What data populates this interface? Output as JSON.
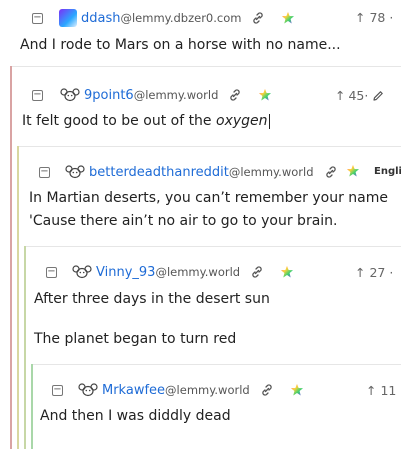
{
  "comments": [
    {
      "username": "ddash",
      "instance": "@lemmy.dbzer0.com",
      "votes": "78",
      "body": [
        "And I rode to Mars on a horse with no name..."
      ],
      "collapse": "−",
      "vote_prefix": "↑"
    },
    {
      "username": "9point6",
      "instance": "@lemmy.world",
      "votes": "45",
      "body_plain": "It felt good to be out of the ",
      "body_italic": "oxygen",
      "collapse": "−",
      "vote_prefix": "↑"
    },
    {
      "username": "betterdeadthanreddit",
      "instance": "@lemmy.world",
      "language": "Engli",
      "body": [
        "In Martian deserts, you can’t remember your name",
        "'Cause there ain’t no air to go to your brain."
      ],
      "collapse": "−"
    },
    {
      "username": "Vinny_93",
      "instance": "@lemmy.world",
      "votes": "27",
      "body": [
        "After three days in the desert sun",
        "The planet began to turn red"
      ],
      "collapse": "−",
      "vote_prefix": "↑"
    },
    {
      "username": "Mrkawfee",
      "instance": "@lemmy.world",
      "votes": "11",
      "body": [
        "And then I was diddly dead"
      ],
      "collapse": "−",
      "vote_prefix": "↑"
    }
  ],
  "colors": {
    "username": "#1e6bd6",
    "thread_line_1": "#d9a3a3",
    "thread_line_2": "#d8d7a0",
    "thread_line_3": "#c7d7a6",
    "thread_line_4": "#a9d7a9"
  },
  "icons": [
    "avatar-icon",
    "link-icon",
    "star-rainbow-icon",
    "reply-icon",
    "more-icon"
  ]
}
